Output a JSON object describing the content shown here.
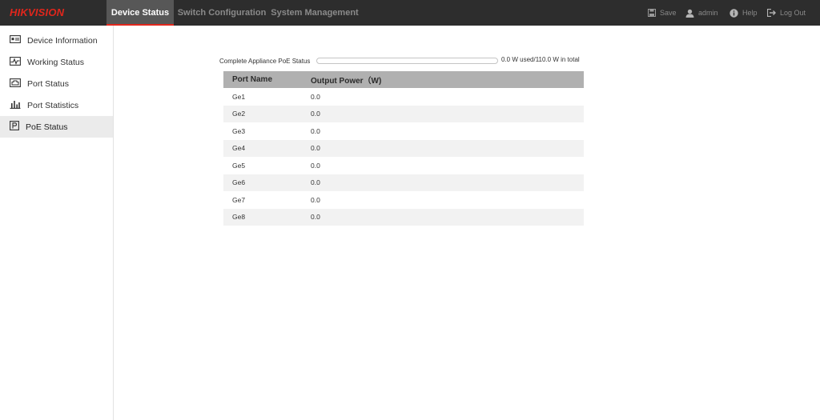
{
  "header": {
    "logo": "HIKVISION",
    "tabs": [
      {
        "label": "Device Status"
      },
      {
        "label": "Switch Configuration"
      },
      {
        "label": "System Management"
      }
    ],
    "actions": {
      "save": "Save",
      "user": "admin",
      "help": "Help",
      "logout": "Log Out"
    }
  },
  "sidebar": {
    "items": [
      {
        "label": "Device Information",
        "icon": "device-info-icon"
      },
      {
        "label": "Working Status",
        "icon": "pulse-icon"
      },
      {
        "label": "Port Status",
        "icon": "port-icon"
      },
      {
        "label": "Port Statistics",
        "icon": "bar-chart-icon"
      },
      {
        "label": "PoE Status",
        "icon": "poe-icon"
      }
    ],
    "active_index": 4
  },
  "poe": {
    "label": "Complete Appliance PoE Status",
    "usage_text": "0.0 W used/110.0 W in total",
    "used_fraction": 0.0
  },
  "table": {
    "headers": {
      "port": "Port Name",
      "power": "Output Power（W)"
    },
    "rows": [
      {
        "port": "Ge1",
        "power": "0.0"
      },
      {
        "port": "Ge2",
        "power": "0.0"
      },
      {
        "port": "Ge3",
        "power": "0.0"
      },
      {
        "port": "Ge4",
        "power": "0.0"
      },
      {
        "port": "Ge5",
        "power": "0.0"
      },
      {
        "port": "Ge6",
        "power": "0.0"
      },
      {
        "port": "Ge7",
        "power": "0.0"
      },
      {
        "port": "Ge8",
        "power": "0.0"
      }
    ]
  },
  "colors": {
    "brand": "#e1261c",
    "topbar": "#2d2d2d",
    "table_header": "#b0b0b0"
  }
}
